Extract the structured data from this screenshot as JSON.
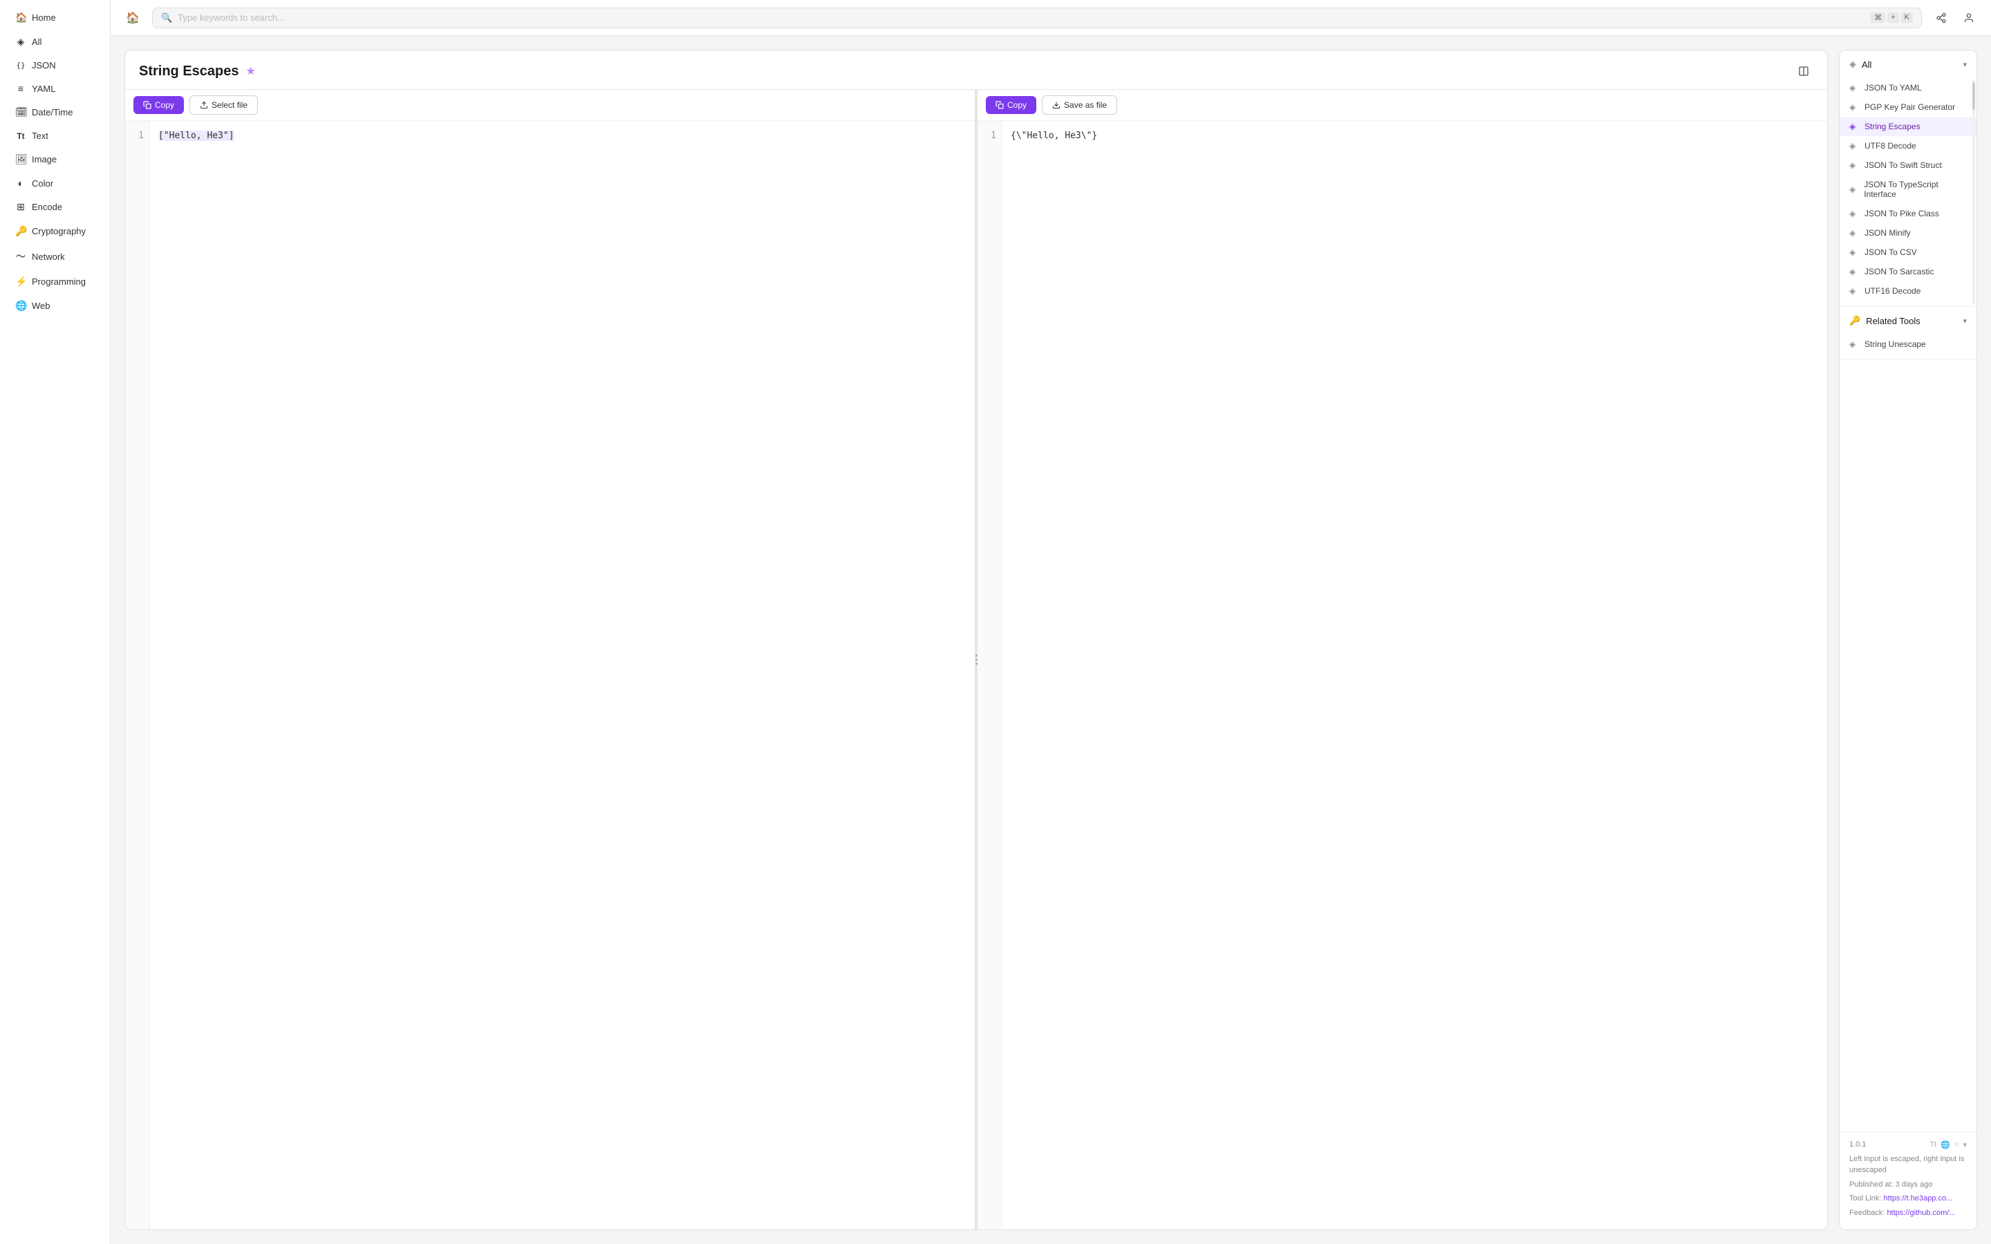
{
  "app": {
    "title": "String Escapes"
  },
  "topbar": {
    "search_placeholder": "Type keywords to search...",
    "shortcut_key1": "⌘",
    "shortcut_plus": "+",
    "shortcut_key2": "K"
  },
  "sidebar": {
    "toggle_label": "collapse",
    "items": [
      {
        "id": "home",
        "label": "Home",
        "icon": "🏠",
        "active": false
      },
      {
        "id": "all",
        "label": "All",
        "icon": "◈",
        "active": false
      },
      {
        "id": "json",
        "label": "JSON",
        "icon": "{}",
        "active": false
      },
      {
        "id": "yaml",
        "label": "YAML",
        "icon": "≡",
        "active": false
      },
      {
        "id": "datetime",
        "label": "Date/Time",
        "icon": "📅",
        "active": false
      },
      {
        "id": "text",
        "label": "Text",
        "icon": "Tt",
        "active": false
      },
      {
        "id": "image",
        "label": "Image",
        "icon": "🖼",
        "active": false
      },
      {
        "id": "color",
        "label": "Color",
        "icon": "◐",
        "active": false
      },
      {
        "id": "encode",
        "label": "Encode",
        "icon": "⊞",
        "active": false
      },
      {
        "id": "cryptography",
        "label": "Cryptography",
        "icon": "🔑",
        "active": false
      },
      {
        "id": "network",
        "label": "Network",
        "icon": "〜",
        "active": false
      },
      {
        "id": "programming",
        "label": "Programming",
        "icon": "⚡",
        "active": false
      },
      {
        "id": "web",
        "label": "Web",
        "icon": "🌐",
        "active": false
      }
    ]
  },
  "tool": {
    "title": "String Escapes",
    "left_pane": {
      "copy_label": "Copy",
      "select_file_label": "Select file",
      "line_number": "1",
      "code": "[\"Hello, He3\"]"
    },
    "right_pane": {
      "copy_label": "Copy",
      "save_as_file_label": "Save as file",
      "line_number": "1",
      "code": "{\\\"Hello, He3\\\"}"
    }
  },
  "all_tools": {
    "section_label": "All",
    "items": [
      {
        "id": "json-to-yaml",
        "label": "JSON To YAML",
        "active": false
      },
      {
        "id": "pgp-key-pair",
        "label": "PGP Key Pair Generator",
        "active": false
      },
      {
        "id": "string-escapes",
        "label": "String Escapes",
        "active": true
      },
      {
        "id": "utf8-decode",
        "label": "UTF8 Decode",
        "active": false
      },
      {
        "id": "json-to-swift",
        "label": "JSON To Swift Struct",
        "active": false
      },
      {
        "id": "json-to-typescript",
        "label": "JSON To TypeScript Interface",
        "active": false
      },
      {
        "id": "json-to-pike",
        "label": "JSON To Pike Class",
        "active": false
      },
      {
        "id": "json-minify",
        "label": "JSON Minify",
        "active": false
      },
      {
        "id": "json-to-csv",
        "label": "JSON To CSV",
        "active": false
      },
      {
        "id": "json-to-sarcastic",
        "label": "JSON To Sarcastic",
        "active": false
      },
      {
        "id": "utf16-decode",
        "label": "UTF16 Decode",
        "active": false
      }
    ]
  },
  "related_tools": {
    "section_label": "Related Tools",
    "items": [
      {
        "id": "string-unescape",
        "label": "String Unescape",
        "active": false
      }
    ]
  },
  "version_info": {
    "version": "1.0.1",
    "description": "Left input is escaped, right input is unescaped",
    "published_label": "Published at:",
    "published_value": "3 days ago",
    "tool_link_label": "Tool Link:",
    "tool_link_url": "https://t.he3app.co...",
    "feedback_label": "Feedback:",
    "feedback_url": "https://github.com/..."
  }
}
